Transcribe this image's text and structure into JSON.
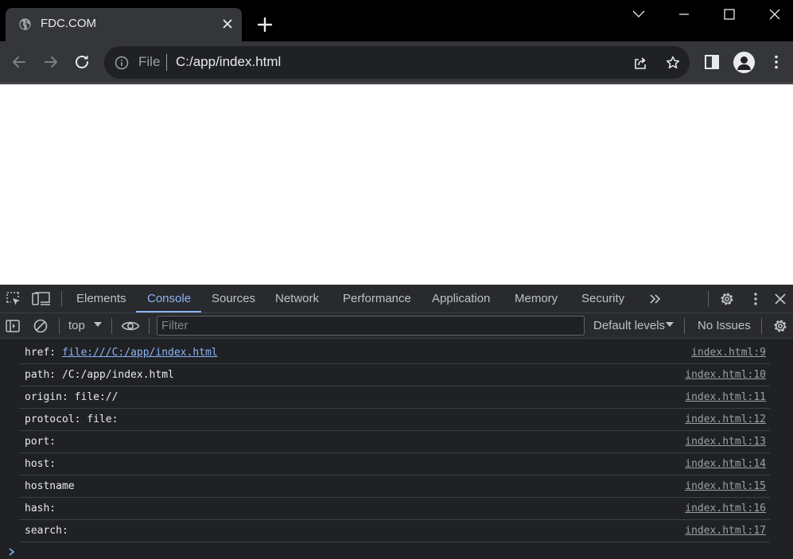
{
  "browser": {
    "tab_title": "FDC.COM",
    "address": {
      "scheme_label": "File",
      "url": "C:/app/index.html"
    }
  },
  "devtools": {
    "tabs": [
      "Elements",
      "Console",
      "Sources",
      "Network",
      "Performance",
      "Application",
      "Memory",
      "Security"
    ],
    "active_tab": "Console",
    "console_toolbar": {
      "context": "top",
      "filter_placeholder": "Filter",
      "levels": "Default levels",
      "issues": "No Issues"
    },
    "messages": [
      {
        "label": "href: ",
        "value": "file:///C:/app/index.html",
        "value_is_link": true,
        "source": "index.html:9"
      },
      {
        "label": "path: ",
        "value": "/C:/app/index.html",
        "value_is_link": false,
        "source": "index.html:10"
      },
      {
        "label": "origin: ",
        "value": "file://",
        "value_is_link": false,
        "source": "index.html:11"
      },
      {
        "label": "protocol: ",
        "value": "file:",
        "value_is_link": false,
        "source": "index.html:12"
      },
      {
        "label": "port: ",
        "value": "",
        "value_is_link": false,
        "source": "index.html:13"
      },
      {
        "label": "host: ",
        "value": "",
        "value_is_link": false,
        "source": "index.html:14"
      },
      {
        "label": "hostname",
        "value": "",
        "value_is_link": false,
        "source": "index.html:15"
      },
      {
        "label": "hash: ",
        "value": "",
        "value_is_link": false,
        "source": "index.html:16"
      },
      {
        "label": "search: ",
        "value": "",
        "value_is_link": false,
        "source": "index.html:17"
      }
    ]
  },
  "icons": {
    "tab_favicon": "globe-icon",
    "tab_close": "close-icon",
    "new_tab": "plus-icon",
    "back": "arrow-left-icon",
    "forward": "arrow-right-icon",
    "reload": "reload-icon",
    "site_info": "info-icon",
    "share": "share-icon",
    "bookmark": "star-icon",
    "side_panel": "side-panel-icon",
    "profile": "avatar-icon",
    "menu": "kebab-menu-icon"
  },
  "colors": {
    "accent": "#8ab4f8",
    "console_bg": "#202124",
    "panel_bg": "#292a2d",
    "tabstrip_bg": "#000000",
    "toolbar_bg": "#35363a"
  }
}
